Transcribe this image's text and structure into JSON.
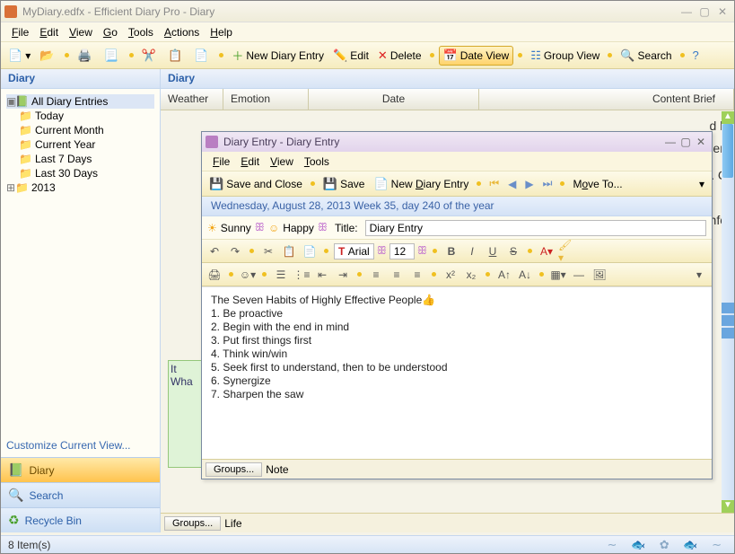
{
  "window": {
    "title": "MyDiary.edfx - Efficient Diary Pro - Diary"
  },
  "menu": {
    "file": "File",
    "edit": "Edit",
    "view": "View",
    "go": "Go",
    "tools": "Tools",
    "actions": "Actions",
    "help": "Help"
  },
  "toolbar": {
    "new_diary": "New Diary Entry",
    "edit": "Edit",
    "delete": "Delete",
    "date_view": "Date View",
    "group_view": "Group View",
    "search": "Search"
  },
  "left": {
    "header": "Diary",
    "root": "All Diary Entries",
    "items": [
      "Today",
      "Current Month",
      "Current Year",
      "Last 7 Days",
      "Last 30 Days",
      "2013"
    ],
    "customize": "Customize Current View...",
    "nav": {
      "diary": "Diary",
      "search": "Search",
      "recycle": "Recycle Bin"
    }
  },
  "right": {
    "header": "Diary",
    "cols": {
      "weather": "Weather",
      "emotion": "Emotion",
      "date": "Date",
      "content": "Content Brief"
    },
    "groups_btn": "Groups...",
    "groups_val": "Life",
    "bg1": "d h",
    "bg2": "en",
    "bg3": "n. C",
    "bg4": "Jnfo"
  },
  "status": {
    "items": "8 Item(s)"
  },
  "dialog": {
    "title": "Diary Entry - Diary Entry",
    "menu": {
      "file": "File",
      "edit": "Edit",
      "view": "View",
      "tools": "Tools"
    },
    "tb": {
      "save_close": "Save and Close",
      "save": "Save",
      "new": "New Diary Entry",
      "move": "Move To..."
    },
    "date_line": "Wednesday, August 28, 2013  Week 35, day 240 of the year",
    "weather": "Sunny",
    "mood": "Happy",
    "title_lbl": "Title:",
    "title_val": "Diary Entry",
    "font_name": "Arial",
    "font_size": "12",
    "body": [
      "The Seven Habits of Highly Effective People",
      "1. Be proactive",
      "2. Begin with the end in mind",
      "3. Put first things first",
      "4. Think win/win",
      "5. Seek first to understand, then to be understood",
      "6. Synergize",
      "7. Sharpen the saw"
    ],
    "groups_btn": "Groups...",
    "groups_val": "Note"
  },
  "behind": {
    "line1": "It",
    "line2": "Wha"
  }
}
